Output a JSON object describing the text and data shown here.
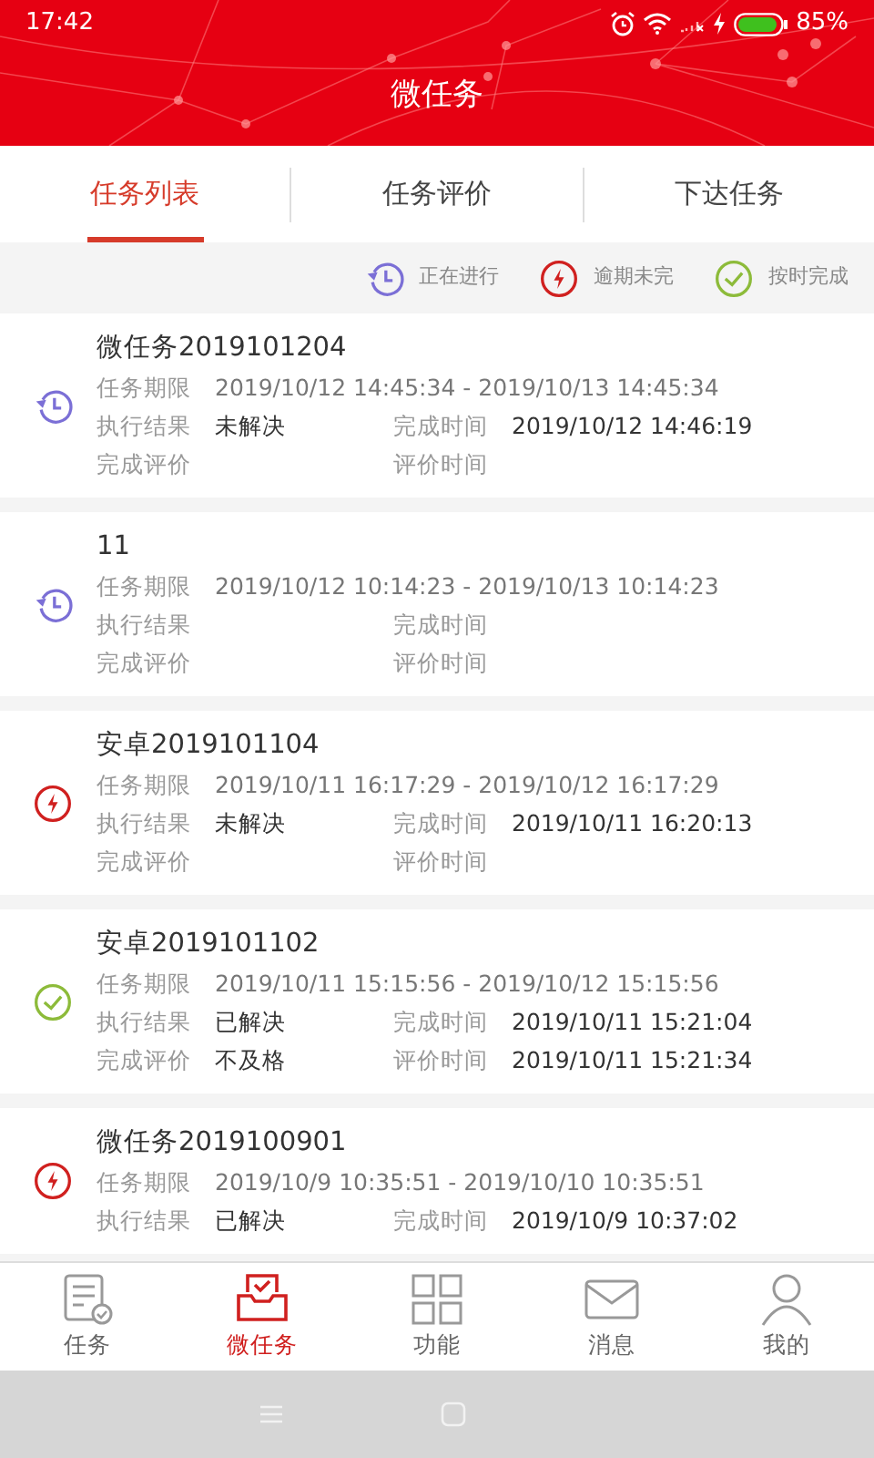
{
  "status_bar": {
    "time": "17:42",
    "battery": "85%"
  },
  "header": {
    "title": "微任务"
  },
  "tabs": [
    {
      "label": "任务列表",
      "selected": true
    },
    {
      "label": "任务评价",
      "selected": false
    },
    {
      "label": "下达任务",
      "selected": false
    }
  ],
  "legend": [
    {
      "kind": "in_progress",
      "label": "正在进行"
    },
    {
      "kind": "overdue",
      "label": "逾期未完"
    },
    {
      "kind": "on_time",
      "label": "按时完成"
    }
  ],
  "tasks": [
    {
      "title": "微任务2019101204",
      "kind": "in_progress",
      "rows": [
        {
          "label": "任务期限",
          "value": "2019/10/12 14:45:34 - 2019/10/13 14:45:34"
        },
        {
          "label": "执行结果",
          "value": "未解决",
          "label2": "完成时间",
          "value2": "2019/10/12 14:46:19"
        },
        {
          "label": "完成评价",
          "label2": "评价时间"
        }
      ]
    },
    {
      "title": "11",
      "kind": "in_progress",
      "rows": [
        {
          "label": "任务期限",
          "value": "2019/10/12 10:14:23 - 2019/10/13 10:14:23"
        },
        {
          "label": "执行结果",
          "label2": "完成时间"
        },
        {
          "label": "完成评价",
          "label2": "评价时间"
        }
      ]
    },
    {
      "title": "安卓2019101104",
      "kind": "overdue",
      "rows": [
        {
          "label": "任务期限",
          "value": "2019/10/11 16:17:29 - 2019/10/12 16:17:29"
        },
        {
          "label": "执行结果",
          "value": "未解决",
          "label2": "完成时间",
          "value2": "2019/10/11 16:20:13"
        },
        {
          "label": "完成评价",
          "label2": "评价时间"
        }
      ]
    },
    {
      "title": "安卓2019101102",
      "kind": "on_time",
      "rows": [
        {
          "label": "任务期限",
          "value": "2019/10/11 15:15:56 - 2019/10/12 15:15:56"
        },
        {
          "label": "执行结果",
          "value": "已解决",
          "label2": "完成时间",
          "value2": "2019/10/11 15:21:04"
        },
        {
          "label": "完成评价",
          "value": "不及格",
          "label2": "评价时间",
          "value2": "2019/10/11 15:21:34"
        }
      ]
    },
    {
      "title": "微任务2019100901",
      "kind": "overdue",
      "rows": [
        {
          "label": "任务期限",
          "value": "2019/10/9 10:35:51 - 2019/10/10 10:35:51"
        },
        {
          "label": "执行结果",
          "value": "已解决",
          "label2": "完成时间",
          "value2": "2019/10/9 10:37:02"
        }
      ]
    }
  ],
  "bottom_nav": [
    {
      "kind": "tasks",
      "label": "任务",
      "selected": false
    },
    {
      "kind": "micro",
      "label": "微任务",
      "selected": true
    },
    {
      "kind": "functions",
      "label": "功能",
      "selected": false
    },
    {
      "kind": "messages",
      "label": "消息",
      "selected": false
    },
    {
      "kind": "me",
      "label": "我的",
      "selected": false
    }
  ]
}
